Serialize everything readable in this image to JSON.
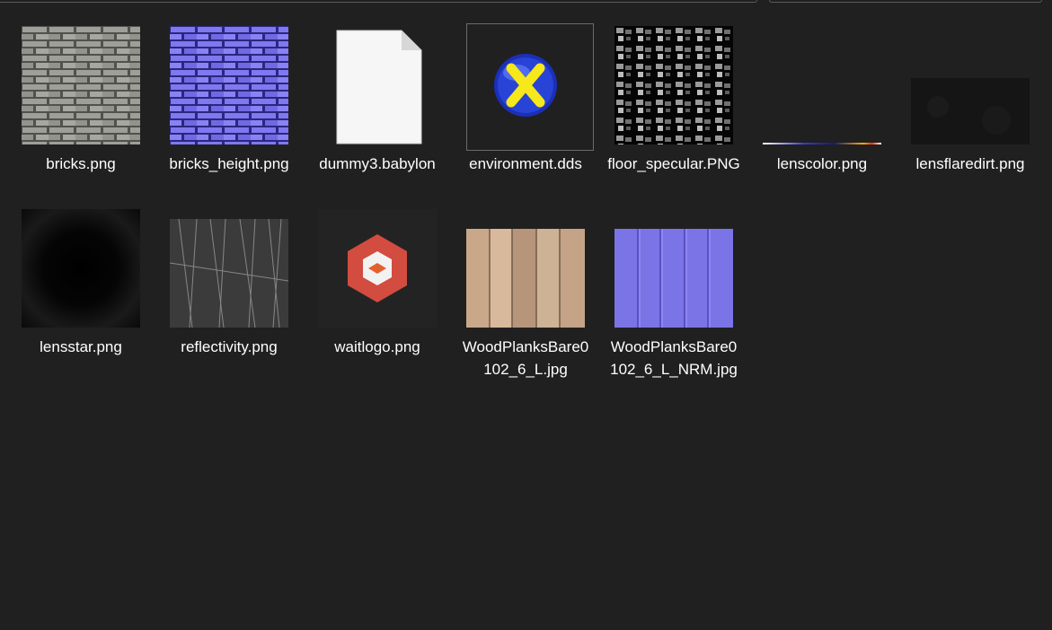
{
  "files": [
    {
      "name": "bricks.png",
      "icon": "bricks-texture"
    },
    {
      "name": "bricks_height.png",
      "icon": "bricks-normal-map"
    },
    {
      "name": "dummy3.babylon",
      "icon": "blank-file-icon"
    },
    {
      "name": "environment.dds",
      "icon": "directx-icon"
    },
    {
      "name": "floor_specular.PNG",
      "icon": "stone-specular-texture"
    },
    {
      "name": "lenscolor.png",
      "icon": "lens-color-strip"
    },
    {
      "name": "lensflaredirt.png",
      "icon": "dark-dirt-texture"
    },
    {
      "name": "lensstar.png",
      "icon": "lens-star-texture"
    },
    {
      "name": "reflectivity.png",
      "icon": "scratched-metal-texture"
    },
    {
      "name": "waitlogo.png",
      "icon": "babylon-logo"
    },
    {
      "name": "WoodPlanksBare0102_6_L.jpg",
      "icon": "wood-planks-texture"
    },
    {
      "name": "WoodPlanksBare0102_6_L_NRM.jpg",
      "icon": "wood-planks-normal-map"
    }
  ],
  "colors": {
    "background": "#202020",
    "text": "#ffffff",
    "normal_map": "#7a74e6"
  }
}
